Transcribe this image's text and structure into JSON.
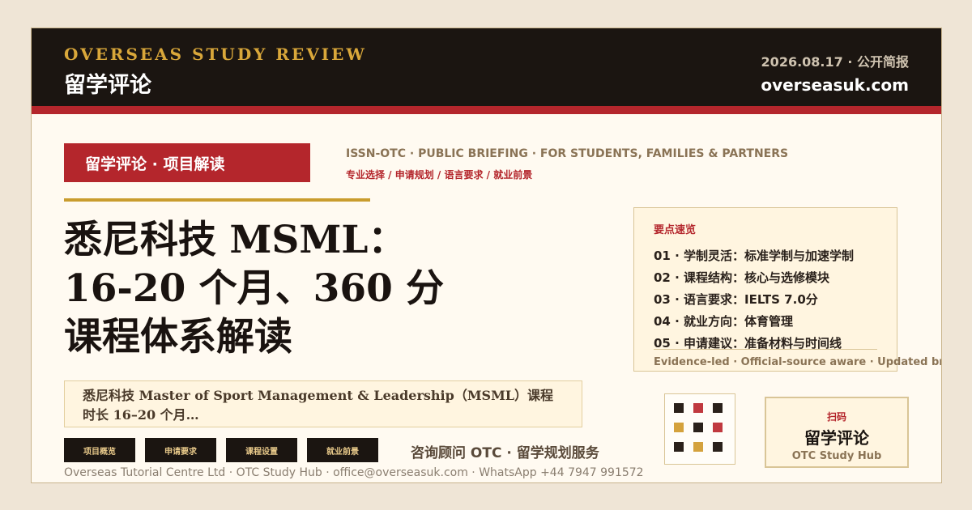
{
  "header": {
    "brand_en": "OVERSEAS STUDY REVIEW",
    "brand_zh": "留学评论",
    "date": "2026.08.17 · 公开简报",
    "site": "overseasuk.com"
  },
  "article": {
    "category": "留学评论 · 项目解读",
    "issn": "ISSN-OTC · PUBLIC BRIEFING · FOR STUDENTS, FAMILIES & PARTNERS",
    "tags": "专业选择 / 申请规划 / 语言要求 / 就业前景",
    "headline": "悉尼科技 MSML：16-20 个月、360 分课程体系解读",
    "summary": "悉尼科技 Master of Sport Management & Leadership（MSML）课程时长 16–20 个月…"
  },
  "key_points": {
    "title": "要点速览",
    "items": [
      "01 · 学制灵活：标准学制与加速学制",
      "02 · 课程结构：核心与选修模块",
      "03 · 语言要求：IELTS 7.0分",
      "04 · 就业方向：体育管理",
      "05 · 申请建议：准备材料与时间线"
    ],
    "footer": "Evidence-led · Official-source aware · Updated briefing"
  },
  "sections": [
    {
      "label": "项目概览"
    },
    {
      "label": "申请要求"
    },
    {
      "label": "课程设置"
    },
    {
      "label": "就业前景"
    }
  ],
  "contact": {
    "label": "咨询顾问 OTC · 留学规划服务"
  },
  "footer": {
    "text": "Overseas Tutorial Centre Ltd · OTC Study Hub · office@overseasuk.com · WhatsApp +44 7947 991572"
  },
  "hub": {
    "badge": "扫码",
    "name": "留学评论",
    "sub": "OTC Study Hub"
  },
  "colors": {
    "dark": "#1b1511",
    "red": "#b4262c",
    "gold": "#c99c2e",
    "cream": "#fffaf1"
  }
}
